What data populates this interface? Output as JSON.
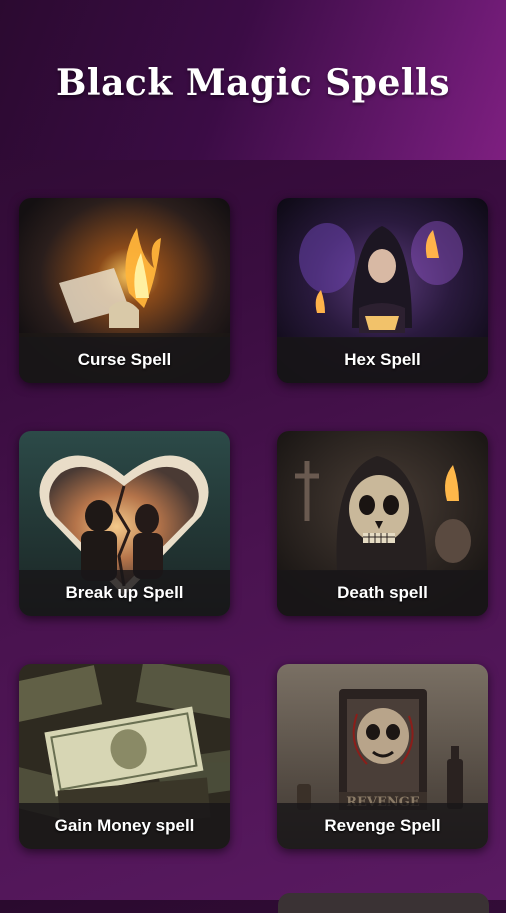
{
  "header": {
    "title": "Black Magic Spells"
  },
  "cards": [
    {
      "label": "Curse Spell"
    },
    {
      "label": "Hex Spell"
    },
    {
      "label": "Break up Spell"
    },
    {
      "label": "Death spell"
    },
    {
      "label": "Gain Money spell"
    },
    {
      "label": "Revenge Spell"
    }
  ],
  "art_text": {
    "revenge_sign": "REVENGE"
  },
  "colors": {
    "header_start": "#2b0a30",
    "header_end": "#7e1f80",
    "background": "#3a0d40",
    "label_bar": "#191619"
  }
}
